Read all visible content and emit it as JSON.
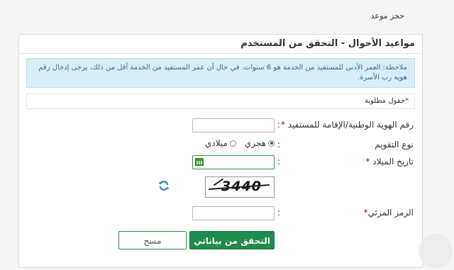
{
  "breadcrumb": "حجز موعد",
  "panel_title": "مواعيد الأحوال - التحقق من المستخدم",
  "notice": "ملاحظة: العمر الأدنى للمستفيد من الخدمة هو 6 سنوات. في حال أن عمر المستفيد من الخدمة أقل من ذلك، يرجى إدخال رقم هوية رب الأسرة.",
  "required_fields": "حقول مطلوبة",
  "form": {
    "id_label": "رقم الهوية الوطنية/الإقامة للمستفيد",
    "id_value": "",
    "calendar_label": "نوع التقويم",
    "calendar_options": [
      "هجري",
      "ميلادي"
    ],
    "calendar_selected": "هجري",
    "dob_label": "تاريخ الميلاد",
    "dob_value": "",
    "captcha_text": "3440",
    "code_label": "الرمز المرئي",
    "code_value": "",
    "colon": ":"
  },
  "buttons": {
    "verify": "التحقق من بياناتي",
    "clear": "مسح"
  },
  "colors": {
    "primary": "#1f8b4c",
    "notice_bg": "#d9edf7",
    "required": "#cc0000"
  },
  "icons": [
    "calendar-icon",
    "refresh-icon"
  ]
}
